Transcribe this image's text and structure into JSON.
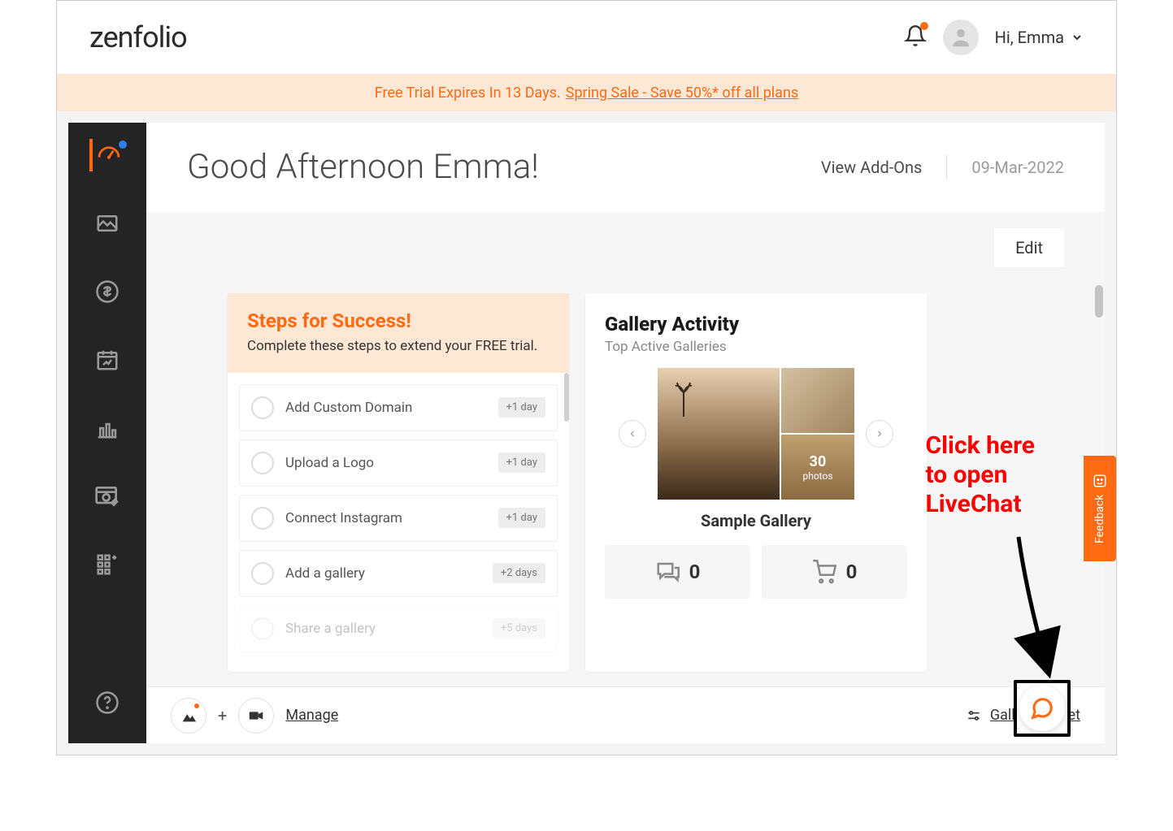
{
  "header": {
    "logo": "zenfolio",
    "greeting_label": "Hi, Emma"
  },
  "banner": {
    "text": "Free Trial Expires In 13 Days.",
    "link": "Spring Sale - Save 50%* off all plans"
  },
  "content_header": {
    "greeting": "Good Afternoon Emma!",
    "addons": "View Add-Ons",
    "date": "09-Mar-2022"
  },
  "edit_label": "Edit",
  "steps": {
    "title": "Steps for Success!",
    "subtitle": "Complete these steps to extend your FREE trial.",
    "items": [
      {
        "label": "Add Custom Domain",
        "badge": "+1 day"
      },
      {
        "label": "Upload a Logo",
        "badge": "+1 day"
      },
      {
        "label": "Connect Instagram",
        "badge": "+1 day"
      },
      {
        "label": "Add a gallery",
        "badge": "+2 days"
      },
      {
        "label": "Share a gallery",
        "badge": "+5 days"
      }
    ]
  },
  "gallery": {
    "title": "Gallery Activity",
    "subtitle": "Top Active Galleries",
    "photo_count": "30",
    "photo_label": "photos",
    "name": "Sample Gallery",
    "comments": "0",
    "cart": "0"
  },
  "bottom": {
    "manage": "Manage",
    "preset": "Gallery Preset"
  },
  "feedback": "Feedback",
  "annotation": {
    "line1": "Click here",
    "line2": "to open",
    "line3": "LiveChat"
  }
}
